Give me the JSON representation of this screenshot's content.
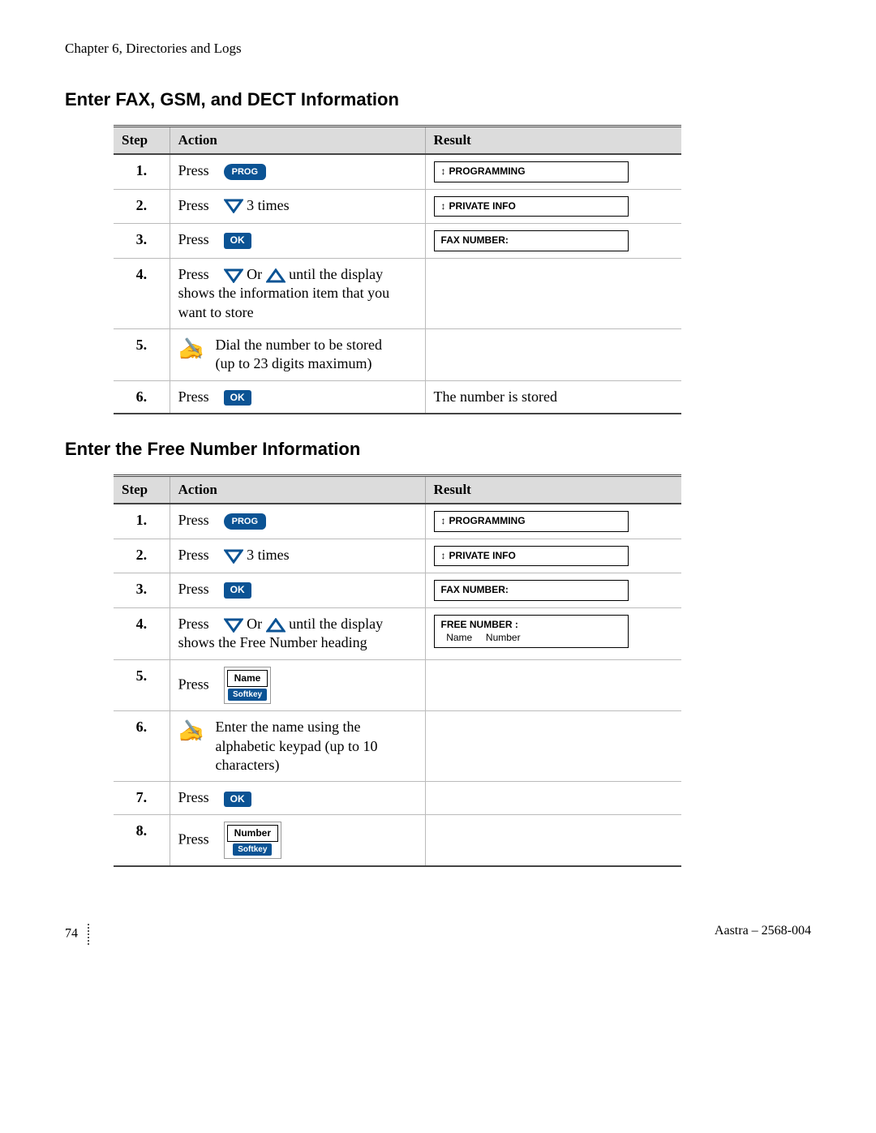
{
  "chapter": "Chapter 6, Directories and Logs",
  "section1_title": "Enter FAX, GSM, and DECT Information",
  "section2_title": "Enter the Free Number Information",
  "headers": {
    "step": "Step",
    "action": "Action",
    "result": "Result"
  },
  "buttons": {
    "prog": "PROG",
    "ok": "OK",
    "softkey": "Softkey",
    "name": "Name",
    "number": "Number"
  },
  "text": {
    "press": "Press",
    "three_times": "3 times",
    "or": "Or",
    "until_display_info": "until the display shows the information item that you want to store",
    "until_display_free": "until the display shows the Free Number heading",
    "dial_number": "Dial the number to be stored (up to 23 digits maximum)",
    "enter_name": "Enter the name using the alphabetic keypad (up to 10 characters)",
    "number_stored": "The number is stored"
  },
  "display": {
    "programming": "PROGRAMMING",
    "private_info": "PRIVATE INFO",
    "fax_number": "FAX NUMBER:",
    "free_number_title": "FREE NUMBER  :",
    "free_number_sub_name": "Name",
    "free_number_sub_number": "Number"
  },
  "table1_steps": [
    "1.",
    "2.",
    "3.",
    "4.",
    "5.",
    "6."
  ],
  "table2_steps": [
    "1.",
    "2.",
    "3.",
    "4.",
    "5.",
    "6.",
    "7.",
    "8."
  ],
  "footer": {
    "page": "74",
    "doc": "Aastra – 2568-004"
  }
}
